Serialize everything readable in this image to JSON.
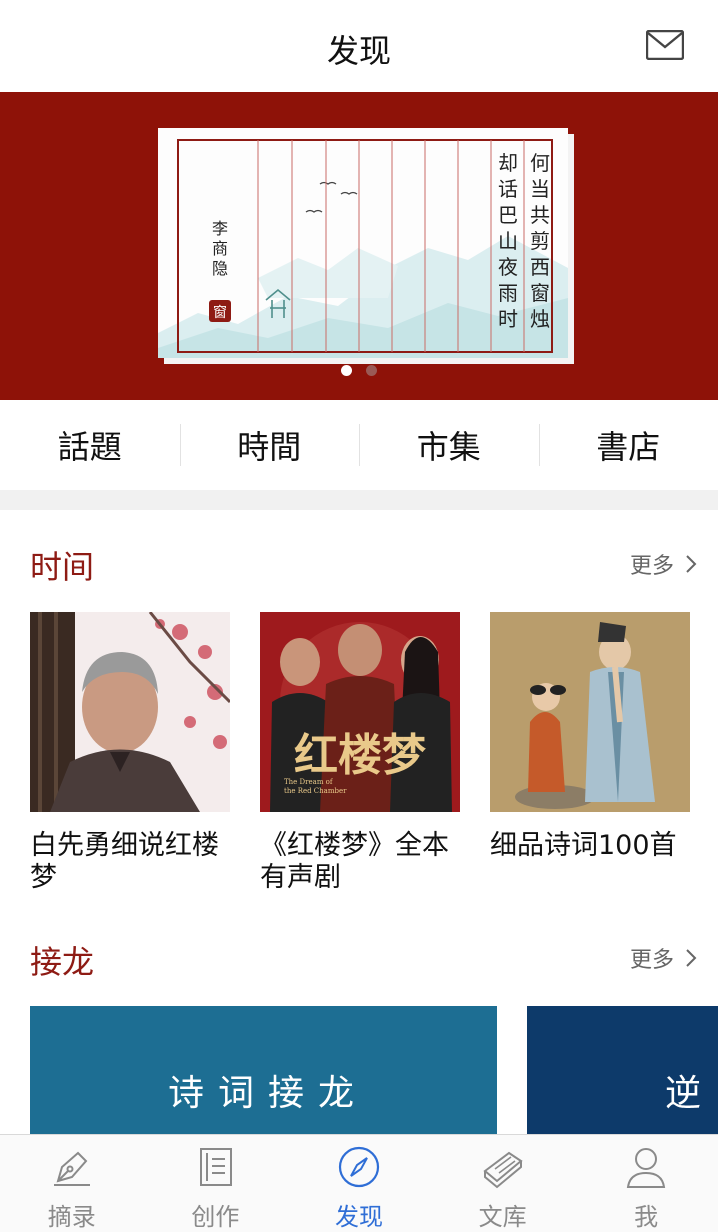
{
  "header": {
    "title": "发现",
    "mail_icon": "mail-icon"
  },
  "banner": {
    "poem_line_1": "何当共剪西窗烛",
    "poem_line_2": "却话巴山夜雨时",
    "author": "李商隐",
    "seal": "窗",
    "slides": 2,
    "active_slide": 1,
    "bg_color": "#8e1208"
  },
  "tabs": [
    {
      "label": "話題"
    },
    {
      "label": "時間"
    },
    {
      "label": "市集"
    },
    {
      "label": "書店"
    }
  ],
  "time_section": {
    "title": "时间",
    "more": "更多",
    "items": [
      {
        "label": "白先勇细说红楼梦"
      },
      {
        "label": "《红楼梦》全本有声剧",
        "cover_title": "红楼梦",
        "cover_subtitle_1": "The Dream of",
        "cover_subtitle_2": "the Red Chamber"
      },
      {
        "label": "细品诗词100首"
      }
    ]
  },
  "relay_section": {
    "title": "接龙",
    "more": "更多",
    "items": [
      {
        "label": "诗词接龙"
      },
      {
        "label": "逆"
      }
    ]
  },
  "bottom_nav": [
    {
      "label": "摘录",
      "icon": "pen-nib-icon",
      "active": false
    },
    {
      "label": "创作",
      "icon": "document-icon",
      "active": false
    },
    {
      "label": "发现",
      "icon": "compass-icon",
      "active": true
    },
    {
      "label": "文库",
      "icon": "books-icon",
      "active": false
    },
    {
      "label": "我",
      "icon": "user-icon",
      "active": false
    }
  ],
  "colors": {
    "accent": "#8e1b14",
    "nav_active": "#2f6ed6"
  }
}
